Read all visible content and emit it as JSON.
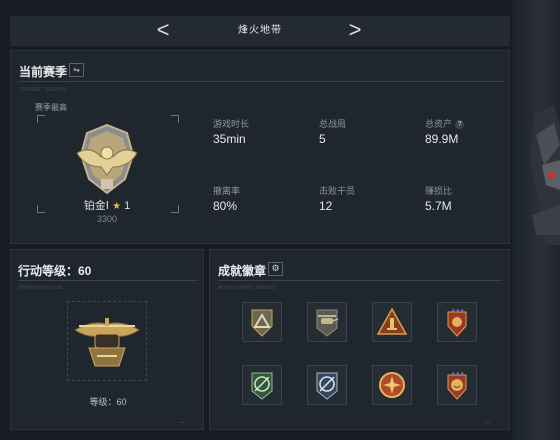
{
  "nav": {
    "title": "烽火地带",
    "prev": "<",
    "next": ">"
  },
  "season": {
    "title": "当前赛季",
    "swap_icon": "⇋",
    "subtitle": "CURRENT SEASON",
    "best_label": "赛季最高",
    "rank_name": "铂金Ⅰ",
    "star": "★",
    "star_count": "1",
    "rank_points": "3300",
    "stats": [
      {
        "label": "游戏时长",
        "value": "35min",
        "help": ""
      },
      {
        "label": "总战局",
        "value": "5",
        "help": ""
      },
      {
        "label": "总资产",
        "value": "89.9M",
        "help": "?"
      },
      {
        "label": "撤离率",
        "value": "80%",
        "help": ""
      },
      {
        "label": "击败干员",
        "value": "12",
        "help": ""
      },
      {
        "label": "赚损比",
        "value": "5.7M",
        "help": ""
      }
    ]
  },
  "action_level": {
    "title": "行动等级：60",
    "subtitle": "OPERATION LEVEL",
    "level_text": "等级：60"
  },
  "achievements": {
    "title": "成就徽章",
    "settings_icon": "gear-icon",
    "subtitle": "ACHIEVEMENT BADGES",
    "badges": [
      {
        "icon": "triangle-shield-badge-icon"
      },
      {
        "icon": "helicopter-badge-icon"
      },
      {
        "icon": "numeral-one-badge-icon"
      },
      {
        "icon": "star-crest-badge-icon"
      },
      {
        "icon": "green-compass-badge-icon"
      },
      {
        "icon": "blue-compass-badge-icon"
      },
      {
        "icon": "gold-cross-badge-icon"
      },
      {
        "icon": "smiley-crest-badge-icon"
      }
    ]
  },
  "colors": {
    "background": "#171c22",
    "panel": "#1f262d",
    "gold": "#c9a45a",
    "text": "#d8dde2"
  }
}
